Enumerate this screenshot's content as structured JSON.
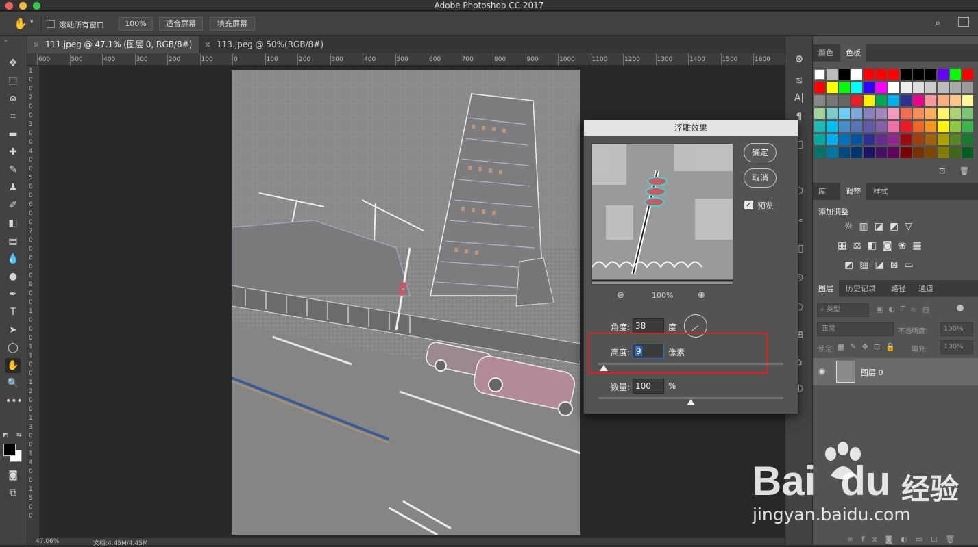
{
  "app": {
    "title": "Adobe Photoshop CC 2017"
  },
  "options_bar": {
    "scroll_all_label": "滚动所有窗口",
    "zoom_100": "100%",
    "fit_screen": "适合屏幕",
    "fill_screen": "填充屏幕"
  },
  "tabs": [
    {
      "label": "111.jpeg @ 47.1% (图层 0, RGB/8#) *",
      "active": true
    },
    {
      "label": "113.jpeg @ 50%(RGB/8#) *",
      "active": false
    }
  ],
  "ruler": {
    "h_labels": [
      "600",
      "500",
      "400",
      "300",
      "200",
      "100",
      "0",
      "100",
      "200",
      "300",
      "400",
      "500",
      "600",
      "700",
      "800",
      "900",
      "1000",
      "1100",
      "1200",
      "1300",
      "1400",
      "1500",
      "1600"
    ],
    "v_labels": [
      "1",
      "0",
      "0",
      "2",
      "0",
      "0",
      "3",
      "0",
      "0",
      "4",
      "0",
      "0",
      "5",
      "0",
      "0",
      "6",
      "0",
      "0",
      "7",
      "0",
      "0",
      "8",
      "0",
      "0",
      "9",
      "0",
      "0",
      "1",
      "0",
      "0",
      "0",
      "1",
      "1",
      "0",
      "0",
      "1",
      "2",
      "0",
      "0",
      "1",
      "3",
      "0",
      "0",
      "1",
      "4",
      "0",
      "0",
      "1",
      "5",
      "0",
      "0"
    ]
  },
  "status": {
    "zoom": "47.06%",
    "doc": "文档:4.45M/4.45M"
  },
  "panels": {
    "color_tabs": [
      "颜色",
      "色板"
    ],
    "adjust_tabs": [
      "库",
      "调整",
      "样式"
    ],
    "add_adjust": "添加调整",
    "layers_tabs": [
      "图层",
      "历史记录",
      "路径",
      "通道"
    ],
    "filter_kind": "类型",
    "blend_mode": "正常",
    "opacity_label": "不透明度:",
    "opacity_value": "100%",
    "lock_label": "锁定:",
    "fill_label": "填充:",
    "fill_value": "100%",
    "layer_name": "图层 0"
  },
  "dialog": {
    "title": "浮雕效果",
    "ok": "确定",
    "cancel": "取消",
    "preview_label": "预览",
    "zoom": "100%",
    "angle_label": "角度:",
    "angle_value": "38",
    "angle_unit": "度",
    "height_label": "高度:",
    "height_value": "9",
    "height_unit": "像素",
    "amount_label": "数量:",
    "amount_value": "100",
    "amount_unit": "%",
    "height_slider_fraction": 0.03,
    "amount_slider_fraction": 0.5
  },
  "watermark": {
    "brand": "Bai",
    "brand2": "du",
    "suffix": "经验",
    "url": "jingyan.baidu.com"
  },
  "colors": {
    "highlight_box": "#e02020",
    "accent": "#2f6fc2"
  }
}
